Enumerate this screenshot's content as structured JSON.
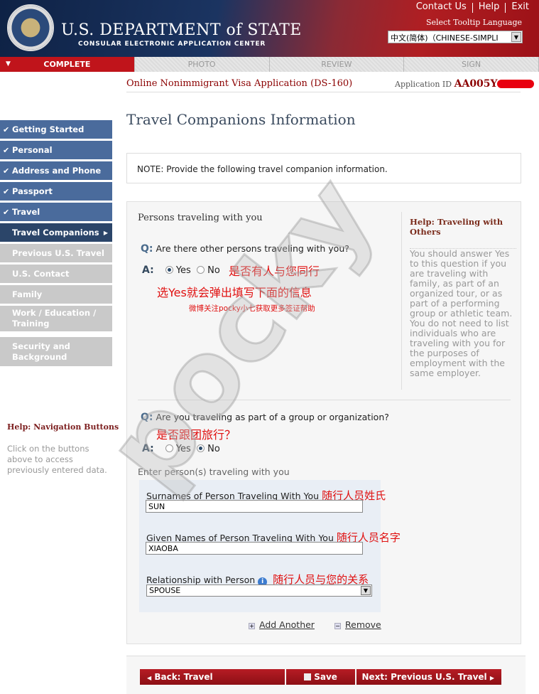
{
  "header": {
    "title": "U.S. DEPARTMENT of STATE",
    "subtitle": "CONSULAR ELECTRONIC APPLICATION CENTER",
    "links": [
      "Contact Us",
      "Help",
      "Exit"
    ],
    "tooltip_label": "Select Tooltip Language",
    "language": "中文(简体)（CHINESE-SIMPLI"
  },
  "tabs": [
    "COMPLETE",
    "PHOTO",
    "REVIEW",
    "SIGN"
  ],
  "form_title": "Online Nonimmigrant Visa Application (DS-160)",
  "app_id_label": "Application ID",
  "app_id": "AA005Y",
  "page_title": "Travel Companions Information",
  "sidebar": {
    "items": [
      {
        "label": "Getting Started",
        "state": "done"
      },
      {
        "label": "Personal",
        "state": "done"
      },
      {
        "label": "Address and Phone",
        "state": "done"
      },
      {
        "label": "Passport",
        "state": "done"
      },
      {
        "label": "Travel",
        "state": "done"
      },
      {
        "label": "Travel Companions",
        "state": "current"
      },
      {
        "label": "Previous U.S. Travel",
        "state": "todo"
      },
      {
        "label": "U.S. Contact",
        "state": "todo"
      },
      {
        "label": "Family",
        "state": "todo"
      },
      {
        "label": "Work / Education / Training",
        "state": "todo"
      },
      {
        "label": "Security and Background",
        "state": "todo"
      }
    ],
    "help_title": "Help: Navigation Buttons",
    "help_text": "Click on the buttons above to access previously entered data."
  },
  "note": "NOTE: Provide the following travel companion information.",
  "section_title": "Persons traveling with you",
  "help": {
    "title": "Help: Traveling with Others",
    "text": "You should answer Yes to this question if you are traveling with family, as part of an organized tour, or as part of a performing group or athletic team. You do not need to list individuals who are traveling with you for the purposes of employment with the same employer."
  },
  "q1": {
    "q": "Q:",
    "text": "Are there other persons traveling with you?",
    "a": "A:",
    "yes": "Yes",
    "no": "No",
    "selected": "Yes",
    "cn1": "是否有人与您同行",
    "cn2": "选Yes就会弹出填写下面的信息",
    "cn3": "微博关注pocky小七获取更多签证帮助"
  },
  "q2": {
    "q": "Q:",
    "text": "Are you traveling as part of a group or organization?",
    "a": "A:",
    "yes": "Yes",
    "no": "No",
    "selected": "No",
    "cn": "是否跟团旅行？"
  },
  "enter_label": "Enter person(s) traveling with you",
  "fields": {
    "surname_label": "Surnames of Person Traveling With You",
    "surname_cn": "随行人员姓氏",
    "surname": "SUN",
    "given_label": "Given Names of Person Traveling With You",
    "given_cn": "随行人员名字",
    "given": "XIAOBA",
    "rel_label": "Relationship with Person",
    "rel_cn": "随行人员与您的关系",
    "rel": "SPOUSE"
  },
  "add_another": "Add Another",
  "remove": "Remove",
  "buttons": {
    "back": "Back: Travel",
    "save": "Save",
    "next": "Next: Previous U.S. Travel"
  },
  "watermark": "pocky小七"
}
